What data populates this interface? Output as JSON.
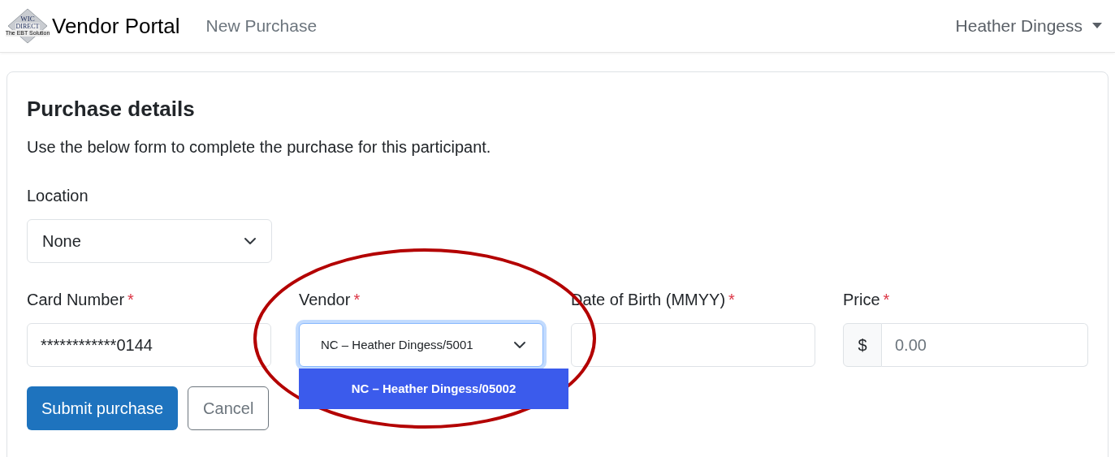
{
  "navbar": {
    "logo": {
      "line_1": "WIC",
      "line_2": "DIRECT",
      "tagline": "The EBT Solution"
    },
    "brand": "Vendor Portal",
    "links": [
      {
        "label": "New Purchase"
      }
    ],
    "user_menu": "Heather Dingess"
  },
  "card": {
    "title": "Purchase details",
    "description": "Use the below form to complete the purchase for this participant.",
    "location": {
      "label": "Location",
      "value": "None"
    },
    "fields": [
      {
        "kind": "text",
        "label": "Card Number",
        "required": true,
        "value": "************0144"
      },
      {
        "kind": "select",
        "label": "Vendor",
        "required": true,
        "value": "NC – Heather Dingess/5001",
        "focused": true,
        "options": [
          {
            "label": "NC – Heather Dingess/05002",
            "selected": true
          }
        ]
      },
      {
        "kind": "text",
        "label": "Date of Birth (MMYY)",
        "required": true
      },
      {
        "kind": "price",
        "label": "Price",
        "required": true,
        "prefix": "$",
        "placeholder": "0.00"
      }
    ],
    "required_mark": "*",
    "buttons": [
      {
        "label": "Submit purchase",
        "kind": "primary"
      },
      {
        "label": "Cancel",
        "kind": "secondary"
      }
    ]
  },
  "annotation": {
    "kind": "ellipse",
    "color": "#b30000"
  }
}
